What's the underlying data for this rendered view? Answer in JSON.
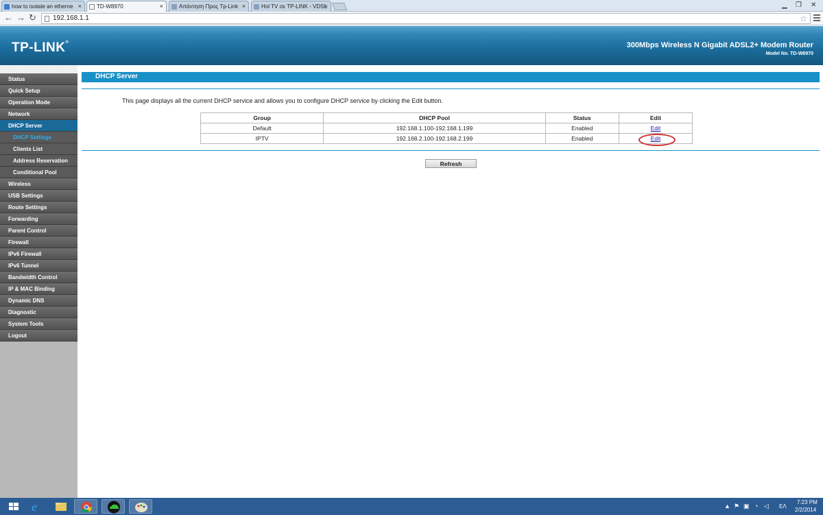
{
  "browser": {
    "tabs": [
      {
        "label": "how to isolate an etherne",
        "active": false,
        "favicon_color": "#3d7fd0"
      },
      {
        "label": "TD-W8970",
        "active": true,
        "favicon_color": "#ffffff"
      },
      {
        "label": "Απάντηση Προς Tp-Link",
        "active": false,
        "favicon_color": "#8aa0c0"
      },
      {
        "label": "Hol TV σε TP-LINK - VDSL",
        "active": false,
        "favicon_color": "#8aa0c0"
      }
    ],
    "address": "192.168.1.1"
  },
  "router": {
    "logo": "TP-LINK",
    "product": "300Mbps Wireless N Gigabit ADSL2+ Modem Router",
    "model": "Model No. TD-W8970"
  },
  "sidebar": {
    "items": [
      {
        "label": "Status",
        "sub": false,
        "active": false
      },
      {
        "label": "Quick Setup",
        "sub": false,
        "active": false
      },
      {
        "label": "Operation Mode",
        "sub": false,
        "active": false
      },
      {
        "label": "Network",
        "sub": false,
        "active": false
      },
      {
        "label": "DHCP Server",
        "sub": false,
        "active": true
      },
      {
        "label": "DHCP Settings",
        "sub": true,
        "active": true
      },
      {
        "label": "Clients List",
        "sub": true,
        "active": false
      },
      {
        "label": "Address Reservation",
        "sub": true,
        "active": false
      },
      {
        "label": "Conditional Pool",
        "sub": true,
        "active": false
      },
      {
        "label": "Wireless",
        "sub": false,
        "active": false
      },
      {
        "label": "USB Settings",
        "sub": false,
        "active": false
      },
      {
        "label": "Route Settings",
        "sub": false,
        "active": false
      },
      {
        "label": "Forwarding",
        "sub": false,
        "active": false
      },
      {
        "label": "Parent Control",
        "sub": false,
        "active": false
      },
      {
        "label": "Firewall",
        "sub": false,
        "active": false
      },
      {
        "label": "IPv6 Firewall",
        "sub": false,
        "active": false
      },
      {
        "label": "IPv6 Tunnel",
        "sub": false,
        "active": false
      },
      {
        "label": "Bandwidth Control",
        "sub": false,
        "active": false
      },
      {
        "label": "IP & MAC Binding",
        "sub": false,
        "active": false
      },
      {
        "label": "Dynamic DNS",
        "sub": false,
        "active": false
      },
      {
        "label": "Diagnostic",
        "sub": false,
        "active": false
      },
      {
        "label": "System Tools",
        "sub": false,
        "active": false
      },
      {
        "label": "Logout",
        "sub": false,
        "active": false
      }
    ]
  },
  "main": {
    "section_title": "DHCP Server",
    "description": "This page displays all the current DHCP service and allows you to configure DHCP service by clicking the Edit button.",
    "table": {
      "headers": [
        "Group",
        "DHCP Pool",
        "Status",
        "Edit"
      ],
      "rows": [
        {
          "group": "Default",
          "pool": "192.168.1.100-192.168.1.199",
          "status": "Enabled",
          "edit": "Edit"
        },
        {
          "group": "IPTV",
          "pool": "192.168.2.100-192.168.2.199",
          "status": "Enabled",
          "edit": "Edit"
        }
      ]
    },
    "refresh_label": "Refresh"
  },
  "taskbar": {
    "time": "7:23 PM",
    "date": "2/2/2014",
    "language": "ΕΛ"
  },
  "colors": {
    "brand_blue": "#1890c8",
    "sidebar_active": "#1a6a99",
    "submenu_active_text": "#2ab0f0",
    "highlight_circle": "#d03030"
  }
}
